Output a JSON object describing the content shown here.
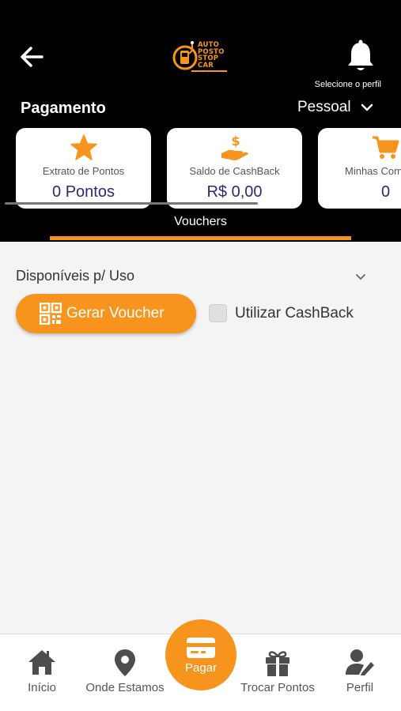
{
  "header": {
    "logo_text": [
      "AUTO",
      "POSTO",
      "STOP",
      "CAR"
    ],
    "profile_label": "Selecione o perfil",
    "page_title": "Pagamento",
    "profile_value": "Pessoal"
  },
  "cards": [
    {
      "label": "Extrato de Pontos",
      "value": "0 Pontos",
      "icon": "star-icon"
    },
    {
      "label": "Saldo de CashBack",
      "value": "R$ 0,00",
      "icon": "cashback-hand-icon"
    },
    {
      "label": "Minhas Compras",
      "value": "0",
      "icon": "cart-icon"
    }
  ],
  "tab": {
    "label": "Vouchers"
  },
  "section": {
    "title": "Disponíveis p/ Uso",
    "voucher_button": "Gerar Voucher",
    "cashback_checkbox": "Utilizar CashBack",
    "cashback_checked": false
  },
  "nav": {
    "home": "Início",
    "locations": "Onde Estamos",
    "pay": "Pagar",
    "rewards": "Trocar Pontos",
    "profile": "Perfil"
  },
  "colors": {
    "accent": "#f7941d",
    "header_bg": "#000000",
    "value_text": "#2b2a78",
    "background": "#f4f4f4"
  }
}
